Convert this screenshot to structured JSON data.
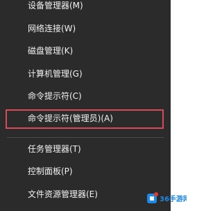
{
  "menu": {
    "items": [
      {
        "label": "设备管理器(M)"
      },
      {
        "label": "网络连接(W)"
      },
      {
        "label": "磁盘管理(K)"
      },
      {
        "label": "计算机管理(G)"
      },
      {
        "label": "命令提示符(C)"
      },
      {
        "label": "命令提示符(管理员)(A)",
        "selected": true
      },
      {
        "label": "任务管理器(T)"
      },
      {
        "label": "控制面板(P)"
      },
      {
        "label": "文件资源管理器(E)"
      }
    ]
  },
  "watermark": {
    "text": "36手游网",
    "brand_color": "#1e88e5",
    "accent_color": "#e53935"
  },
  "colors": {
    "menu_background": "#2b2b2b",
    "menu_text": "#f2f2f2",
    "separator": "#4a4a4a",
    "highlight_border": "#d64a5a"
  }
}
